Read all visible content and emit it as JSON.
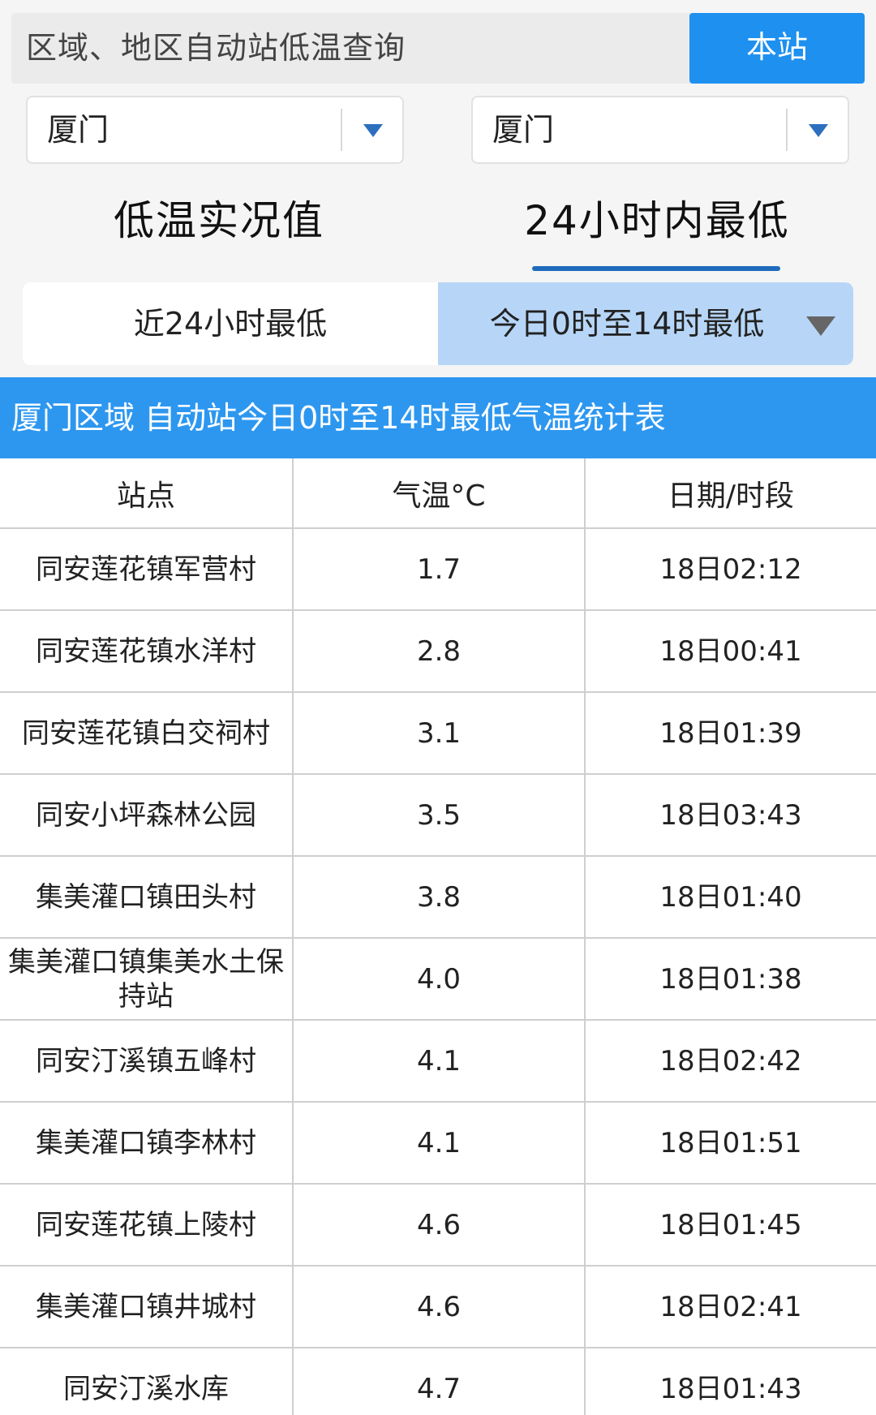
{
  "header": {
    "title": "区域、地区自动站低温查询",
    "station_button": "本站"
  },
  "selects": {
    "region": "厦门",
    "area": "厦门"
  },
  "tabs": {
    "left": "低温实况值",
    "right": "24小时内最低"
  },
  "subtabs": {
    "first": "近24小时最低",
    "second": "今日0时至14时最低"
  },
  "banner": "厦门区域 自动站今日0时至14时最低气温统计表",
  "table": {
    "headers": [
      "站点",
      "气温°C",
      "日期/时段"
    ],
    "rows": [
      [
        "同安莲花镇军营村",
        "1.7",
        "18日02:12"
      ],
      [
        "同安莲花镇水洋村",
        "2.8",
        "18日00:41"
      ],
      [
        "同安莲花镇白交祠村",
        "3.1",
        "18日01:39"
      ],
      [
        "同安小坪森林公园",
        "3.5",
        "18日03:43"
      ],
      [
        "集美灌口镇田头村",
        "3.8",
        "18日01:40"
      ],
      [
        "集美灌口镇集美水土保持站",
        "4.0",
        "18日01:38"
      ],
      [
        "同安汀溪镇五峰村",
        "4.1",
        "18日02:42"
      ],
      [
        "集美灌口镇李林村",
        "4.1",
        "18日01:51"
      ],
      [
        "同安莲花镇上陵村",
        "4.6",
        "18日01:45"
      ],
      [
        "集美灌口镇井城村",
        "4.6",
        "18日02:41"
      ],
      [
        "同安汀溪水库",
        "4.7",
        "18日01:43"
      ]
    ]
  },
  "colors": {
    "primary_blue": "#1e90f0",
    "banner_blue": "#2d97f0",
    "active_subtab": "#b7d6f7",
    "tab_underline": "#1f6bbd"
  }
}
